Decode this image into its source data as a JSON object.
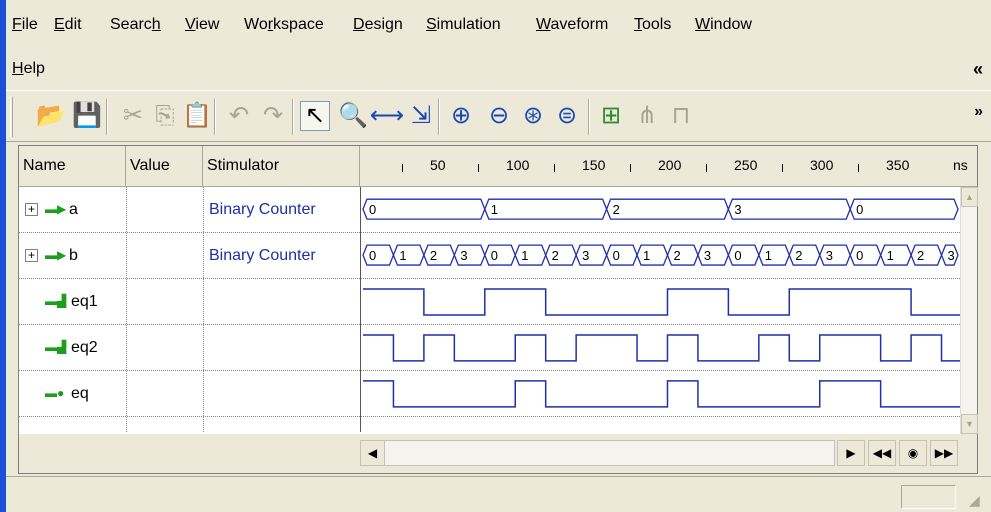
{
  "menu": {
    "items": [
      {
        "label": "File",
        "u": "F",
        "rest": "ile"
      },
      {
        "label": "Edit",
        "u": "E",
        "rest": "dit"
      },
      {
        "label": "Search",
        "pre": "Searc",
        "u": "h",
        "rest": ""
      },
      {
        "label": "View",
        "u": "V",
        "rest": "iew"
      },
      {
        "label": "Workspace",
        "pre": "Wo",
        "u": "r",
        "rest": "kspace"
      },
      {
        "label": "Design",
        "u": "D",
        "rest": "esign"
      },
      {
        "label": "Simulation",
        "u": "S",
        "rest": "imulation"
      },
      {
        "label": "Waveform",
        "u": "W",
        "rest": "aveform"
      },
      {
        "label": "Tools",
        "u": "T",
        "rest": "ools"
      },
      {
        "label": "Window",
        "u": "W",
        "rest": "indow"
      },
      {
        "label": "Help",
        "u": "H",
        "rest": "elp"
      }
    ],
    "chevron": "«"
  },
  "toolbar": {
    "icons": [
      "open-folder-icon",
      "save-disk-icon",
      "cut-icon",
      "copy-icon",
      "paste-icon",
      "undo-icon",
      "redo-icon",
      "select-pointer-icon",
      "zoom-icon",
      "time-measure-icon",
      "signal-select-icon",
      "zoom-in-icon",
      "zoom-out-icon",
      "zoom-region-icon",
      "zoom-fit-icon",
      "add-signal-icon",
      "signal-bus-icon",
      "hierarchy-icon"
    ],
    "chevron": "»"
  },
  "columns": {
    "name": "Name",
    "value": "Value",
    "stimulator": "Stimulator"
  },
  "ruler": {
    "labels": [
      "50",
      "100",
      "150",
      "200",
      "250",
      "300",
      "350"
    ],
    "unit": "ns"
  },
  "signals": [
    {
      "name": "a",
      "type": "input-bus",
      "stimulator": "Binary Counter",
      "expandable": true
    },
    {
      "name": "b",
      "type": "input-bus",
      "stimulator": "Binary Counter",
      "expandable": true
    },
    {
      "name": "eq1",
      "type": "internal",
      "stimulator": "",
      "expandable": false
    },
    {
      "name": "eq2",
      "type": "internal",
      "stimulator": "",
      "expandable": false
    },
    {
      "name": "eq",
      "type": "output",
      "stimulator": "",
      "expandable": false
    }
  ],
  "waveforms": {
    "a": [
      "0",
      "1",
      "2",
      "3",
      "0"
    ],
    "b": [
      "0",
      "1",
      "2",
      "3",
      "0",
      "1",
      "2",
      "3",
      "0",
      "1",
      "2",
      "3",
      "0",
      "1",
      "2",
      "3",
      "0",
      "1",
      "2",
      "3"
    ]
  },
  "colors": {
    "wave": "#1f2fa8",
    "signal_icon": "#1c9e1c",
    "stimulator_text": "#1f2fa8",
    "title_blue": "#1a4fd6"
  }
}
